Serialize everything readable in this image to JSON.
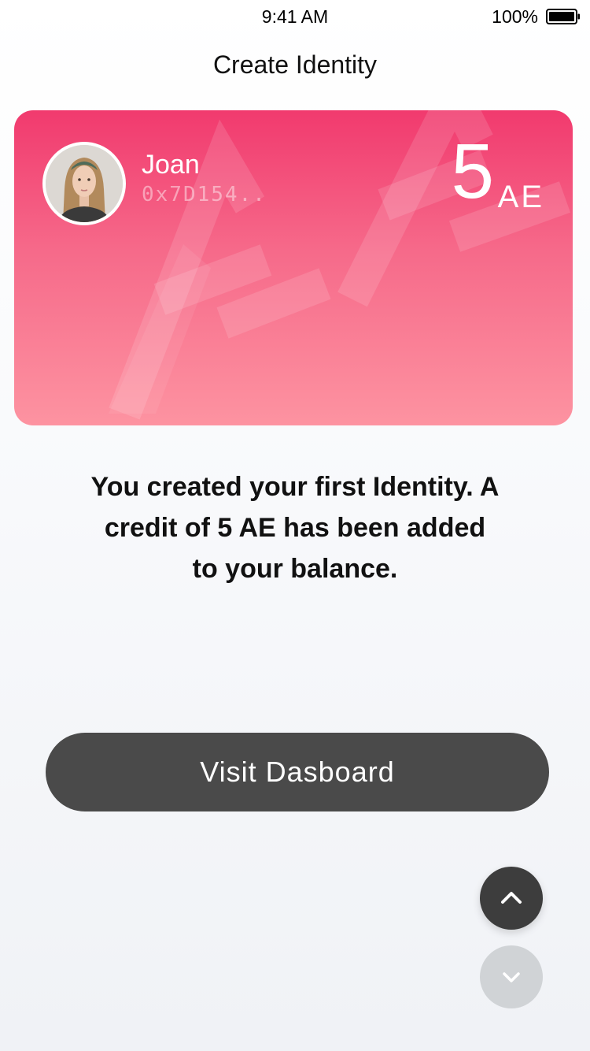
{
  "status_bar": {
    "time": "9:41 AM",
    "battery": "100%"
  },
  "header": {
    "title": "Create Identity"
  },
  "card": {
    "name": "Joan",
    "address": "0x7D154..",
    "balance": "5",
    "unit": "AE",
    "watermark": "AE",
    "colors": {
      "gradient_top": "#f13a6e",
      "gradient_bottom": "#fd93a1"
    }
  },
  "message": {
    "line1": "You created your first Identity. A",
    "line2": "credit of 5 AE has been added",
    "line3": "to your balance."
  },
  "actions": {
    "visit_dashboard_label": "Visit Dasboard",
    "button_color": "#4a4a4a"
  },
  "scroll_controls": {
    "up_icon": "chevron-up-icon",
    "down_icon": "chevron-down-icon"
  }
}
